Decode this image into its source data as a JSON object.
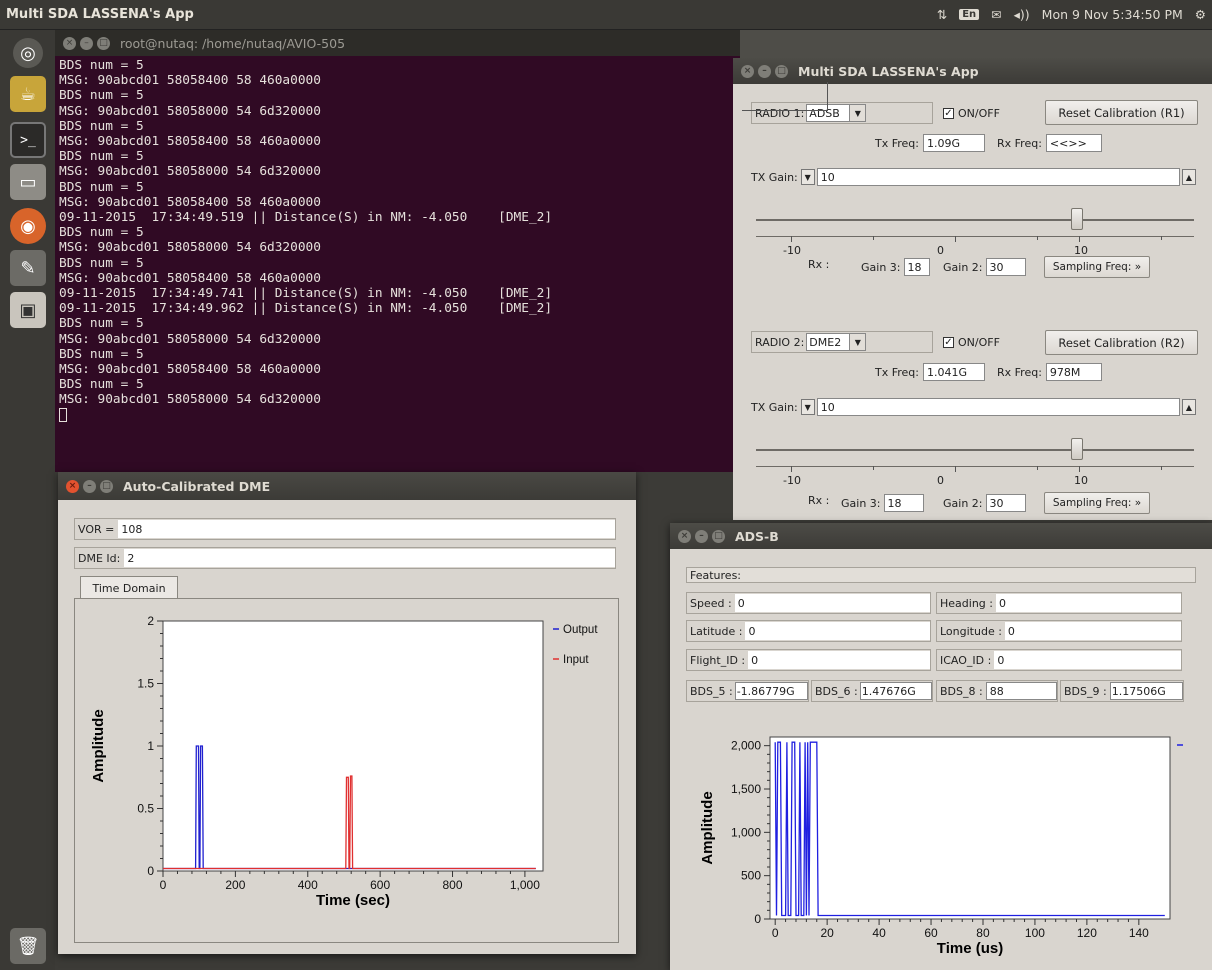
{
  "topbar": {
    "app_title": "Multi SDA LASSENA's App",
    "keyboard": "En",
    "volume": "◂))",
    "clock": "Mon 9 Nov 5:34:50 PM"
  },
  "terminal": {
    "title": "root@nutaq: /home/nutaq/AVIO-505",
    "lines": [
      "BDS num = 5",
      "MSG: 90abcd01 58058400 58 460a0000",
      "BDS num = 5",
      "MSG: 90abcd01 58058000 54 6d320000",
      "BDS num = 5",
      "MSG: 90abcd01 58058400 58 460a0000",
      "BDS num = 5",
      "MSG: 90abcd01 58058000 54 6d320000",
      "BDS num = 5",
      "MSG: 90abcd01 58058400 58 460a0000",
      "09-11-2015  17:34:49.519 || Distance(S) in NM: -4.050    [DME_2]",
      "BDS num = 5",
      "MSG: 90abcd01 58058000 54 6d320000",
      "BDS num = 5",
      "MSG: 90abcd01 58058400 58 460a0000",
      "09-11-2015  17:34:49.741 || Distance(S) in NM: -4.050    [DME_2]",
      "09-11-2015  17:34:49.962 || Distance(S) in NM: -4.050    [DME_2]",
      "BDS num = 5",
      "MSG: 90abcd01 58058000 54 6d320000",
      "BDS num = 5",
      "MSG: 90abcd01 58058400 58 460a0000",
      "BDS num = 5",
      "MSG: 90abcd01 58058000 54 6d320000"
    ]
  },
  "lassena": {
    "title": "Multi SDA LASSENA's App",
    "radio1": {
      "label": "RADIO 1:",
      "mode": "ADSB",
      "onoff": "ON/OFF",
      "reset": "Reset Calibration (R1)",
      "tx_label": "Tx Freq:",
      "tx_value": "1.09G",
      "rx_label": "Rx Freq:",
      "rx_value": "<<>>",
      "txgain_label": "TX Gain:",
      "txgain_value": "10",
      "scale": [
        "-10",
        "0",
        "10"
      ],
      "rx_text": "Rx :",
      "gain3_label": "Gain 3:",
      "gain3_value": "18",
      "gain2_label": "Gain 2:",
      "gain2_value": "30",
      "sampling": "Sampling Freq: »"
    },
    "radio2": {
      "label": "RADIO 2:",
      "mode": "DME2",
      "onoff": "ON/OFF",
      "reset": "Reset Calibration (R2)",
      "tx_label": "Tx Freq:",
      "tx_value": "1.041G",
      "rx_label": "Rx Freq:",
      "rx_value": "978M",
      "txgain_label": "TX Gain:",
      "txgain_value": "10",
      "scale": [
        "-10",
        "0",
        "10"
      ],
      "rx_text": "Rx :",
      "gain3_label": "Gain 3:",
      "gain3_value": "18",
      "gain2_label": "Gain 2:",
      "gain2_value": "30",
      "sampling": "Sampling Freq: »"
    }
  },
  "dme": {
    "title": "Auto-Calibrated DME",
    "vor_label": "VOR =",
    "vor_value": "108",
    "dmeid_label": "DME Id:",
    "dmeid_value": "2",
    "tab": "Time Domain"
  },
  "adsb": {
    "title": "ADS-B",
    "features": "Features:",
    "speed_label": "Speed :",
    "speed_value": "0",
    "heading_label": "Heading :",
    "heading_value": "0",
    "lat_label": "Latitude :",
    "lat_value": "0",
    "lon_label": "Longitude :",
    "lon_value": "0",
    "flight_label": "Flight_ID :",
    "flight_value": "0",
    "icao_label": "ICAO_ID :",
    "icao_value": "0",
    "bds5_label": "BDS_5 :",
    "bds5_value": "-1.86779G",
    "bds6_label": "BDS_6 :",
    "bds6_value": "1.47676G",
    "bds8_label": "BDS_8 :",
    "bds8_value": "88",
    "bds9_label": "BDS_9 :",
    "bds9_value": "1.17506G"
  },
  "chart_data": [
    {
      "type": "line",
      "xlabel": "Time (sec)",
      "ylabel": "Amplitude",
      "xlim": [
        0,
        1050
      ],
      "ylim": [
        0,
        2
      ],
      "xticks": [
        "0",
        "200",
        "400",
        "600",
        "800",
        "1,000"
      ],
      "yticks": [
        "0",
        "0.5",
        "1",
        "1.5",
        "2"
      ],
      "legend_position": "top-right",
      "grid": false,
      "series": [
        {
          "name": "Output",
          "color": "#2020d0",
          "points": [
            [
              0,
              0.02
            ],
            [
              90,
              0.02
            ],
            [
              92,
              1
            ],
            [
              98,
              1
            ],
            [
              100,
              0.02
            ],
            [
              102,
              0.02
            ],
            [
              104,
              1
            ],
            [
              109,
              1
            ],
            [
              111,
              0.02
            ],
            [
              1030,
              0.02
            ]
          ]
        },
        {
          "name": "Input",
          "color": "#e03030",
          "points": [
            [
              0,
              0.02
            ],
            [
              505,
              0.02
            ],
            [
              507,
              0.75
            ],
            [
              512,
              0.75
            ],
            [
              514,
              0.02
            ],
            [
              516,
              0.02
            ],
            [
              518,
              0.76
            ],
            [
              522,
              0.76
            ],
            [
              524,
              0.02
            ],
            [
              1030,
              0.02
            ]
          ]
        }
      ]
    },
    {
      "type": "line",
      "xlabel": "Time (us)",
      "ylabel": "Amplitude",
      "xlim": [
        -2,
        152
      ],
      "ylim": [
        0,
        2100
      ],
      "xticks": [
        "0",
        "20",
        "40",
        "60",
        "80",
        "100",
        "120",
        "140"
      ],
      "yticks": [
        "0",
        "500",
        "1,000",
        "1,500",
        "2,000"
      ],
      "grid": false,
      "series": [
        {
          "color": "#2020e0",
          "points": [
            [
              0,
              2040
            ],
            [
              0.5,
              40
            ],
            [
              1,
              2040
            ],
            [
              2,
              2040
            ],
            [
              2.5,
              40
            ],
            [
              4,
              40
            ],
            [
              4.5,
              2040
            ],
            [
              5,
              40
            ],
            [
              6,
              40
            ],
            [
              6.5,
              2040
            ],
            [
              7.5,
              2040
            ],
            [
              8,
              40
            ],
            [
              9,
              40
            ],
            [
              9.5,
              2040
            ],
            [
              10,
              40
            ],
            [
              11,
              40
            ],
            [
              11.5,
              2040
            ],
            [
              12,
              40
            ],
            [
              12.5,
              2040
            ],
            [
              13,
              40
            ],
            [
              13.5,
              2040
            ],
            [
              16,
              2040
            ],
            [
              16.5,
              40
            ],
            [
              150,
              40
            ]
          ]
        }
      ]
    }
  ]
}
